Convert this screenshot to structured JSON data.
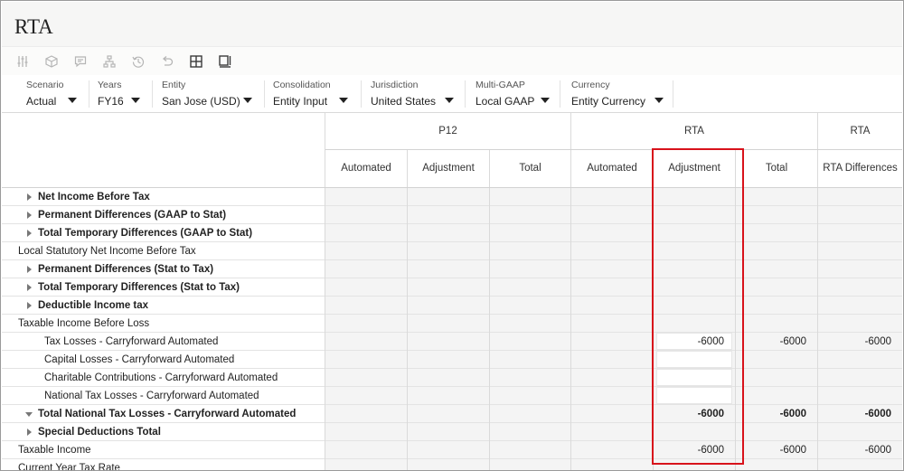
{
  "app": {
    "title": "RTA"
  },
  "toolbar": {
    "icons": [
      "sliders-icon",
      "cube-icon",
      "comment-icon",
      "hierarchy-icon",
      "history-icon",
      "undo-icon",
      "grid-icon",
      "panel-icon"
    ]
  },
  "pov": [
    {
      "label": "Scenario",
      "value": "Actual"
    },
    {
      "label": "Years",
      "value": "FY16"
    },
    {
      "label": "Entity",
      "value": "San Jose (USD)"
    },
    {
      "label": "Consolidation",
      "value": "Entity Input"
    },
    {
      "label": "Jurisdiction",
      "value": "United States"
    },
    {
      "label": "Multi-GAAP",
      "value": "Local GAAP"
    },
    {
      "label": "Currency",
      "value": "Entity Currency"
    }
  ],
  "grid": {
    "groups": [
      "P12",
      "RTA",
      "RTA"
    ],
    "columns": [
      "Automated",
      "Adjustment",
      "Total",
      "Automated",
      "Adjustment",
      "Total",
      "RTA Differences"
    ],
    "rows": [
      {
        "label": "Net Income Before Tax",
        "bold": true,
        "expander": "collapsed",
        "indent": 1,
        "values": [
          "",
          "",
          "",
          "",
          "",
          "",
          ""
        ]
      },
      {
        "label": "Permanent Differences (GAAP to Stat)",
        "bold": true,
        "expander": "collapsed",
        "indent": 1,
        "values": [
          "",
          "",
          "",
          "",
          "",
          "",
          ""
        ]
      },
      {
        "label": "Total Temporary Differences (GAAP to Stat)",
        "bold": true,
        "expander": "collapsed",
        "indent": 1,
        "values": [
          "",
          "",
          "",
          "",
          "",
          "",
          ""
        ]
      },
      {
        "label": "Local Statutory Net Income Before Tax",
        "bold": false,
        "expander": "none",
        "indent": 0,
        "values": [
          "",
          "",
          "",
          "",
          "",
          "",
          ""
        ]
      },
      {
        "label": "Permanent Differences (Stat to Tax)",
        "bold": true,
        "expander": "collapsed",
        "indent": 1,
        "values": [
          "",
          "",
          "",
          "",
          "",
          "",
          ""
        ]
      },
      {
        "label": "Total Temporary Differences (Stat to Tax)",
        "bold": true,
        "expander": "collapsed",
        "indent": 1,
        "values": [
          "",
          "",
          "",
          "",
          "",
          "",
          ""
        ]
      },
      {
        "label": "Deductible Income tax",
        "bold": true,
        "expander": "collapsed",
        "indent": 1,
        "values": [
          "",
          "",
          "",
          "",
          "",
          "",
          ""
        ]
      },
      {
        "label": "Taxable Income Before Loss",
        "bold": false,
        "expander": "none",
        "indent": 0,
        "values": [
          "",
          "",
          "",
          "",
          "",
          "",
          ""
        ]
      },
      {
        "label": "Tax Losses - Carryforward Automated",
        "bold": false,
        "expander": "none",
        "indent": 2,
        "editable": true,
        "values": [
          "",
          "",
          "",
          "",
          "-6000",
          "-6000",
          "-6000"
        ]
      },
      {
        "label": "Capital Losses - Carryforward Automated",
        "bold": false,
        "expander": "none",
        "indent": 2,
        "editable": true,
        "values": [
          "",
          "",
          "",
          "",
          "",
          "",
          ""
        ]
      },
      {
        "label": "Charitable Contributions - Carryforward Automated",
        "bold": false,
        "expander": "none",
        "indent": 2,
        "editable": true,
        "values": [
          "",
          "",
          "",
          "",
          "",
          "",
          ""
        ]
      },
      {
        "label": "National Tax Losses - Carryforward Automated",
        "bold": false,
        "expander": "none",
        "indent": 2,
        "editable": true,
        "values": [
          "",
          "",
          "",
          "",
          "",
          "",
          ""
        ]
      },
      {
        "label": "Total National Tax Losses - Carryforward Automated",
        "bold": true,
        "expander": "expanded",
        "indent": 1,
        "values": [
          "",
          "",
          "",
          "",
          "-6000",
          "-6000",
          "-6000"
        ]
      },
      {
        "label": "Special Deductions Total",
        "bold": true,
        "expander": "collapsed",
        "indent": 1,
        "values": [
          "",
          "",
          "",
          "",
          "",
          "",
          ""
        ]
      },
      {
        "label": "Taxable Income",
        "bold": false,
        "expander": "none",
        "indent": 0,
        "values": [
          "",
          "",
          "",
          "",
          "-6000",
          "-6000",
          "-6000"
        ]
      },
      {
        "label": "Current Year Tax Rate",
        "bold": false,
        "expander": "none",
        "indent": 0,
        "values": [
          "",
          "",
          "",
          "",
          "",
          "",
          ""
        ]
      }
    ]
  },
  "colors": {
    "highlight": "#d8121b",
    "shaded": "#f4f4f4"
  }
}
